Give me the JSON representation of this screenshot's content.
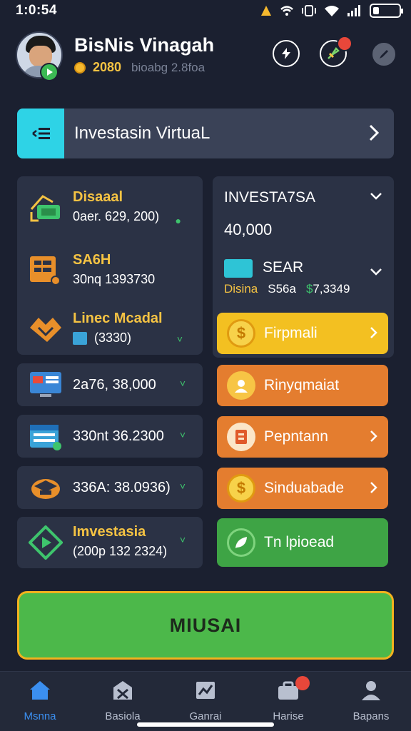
{
  "status_bar": {
    "time": "1:0:54"
  },
  "header": {
    "user_name": "BisNis Vinagah",
    "coins": "2080",
    "coins_sub": "bioabg 2.8foa"
  },
  "banner": {
    "title": "Investasin VirtuaL"
  },
  "left_panel": {
    "items": [
      {
        "title": "Disaaal",
        "sub": "0aer. 629, 200)"
      },
      {
        "title": "SA6H",
        "sub": "30nq 1393730"
      },
      {
        "title": "Linec Mcadal",
        "sub": "(3330)"
      }
    ]
  },
  "left_cards": [
    {
      "text": "2a76, 38,000"
    },
    {
      "text": "330nt 36.2300"
    },
    {
      "text": "336A: 38.0936)"
    }
  ],
  "left_tall_card": {
    "title": "Imvestasia",
    "sub": "(200p 132 2324)"
  },
  "right_panel": {
    "title": "INVESTA7SA",
    "amount": "40,000",
    "gear_label": "SEAR",
    "row": [
      "Disina",
      "S56a",
      "7,3349"
    ]
  },
  "action_buttons": [
    {
      "label": "Firpmali",
      "color": "#f3c021",
      "icon": "dollar-coin-icon"
    },
    {
      "label": "Rinyqmaiat",
      "color": "#e47d2f",
      "icon": "person-icon"
    },
    {
      "label": "Pepntann",
      "color": "#e47d2f",
      "icon": "document-icon"
    },
    {
      "label": "Sinduabade",
      "color": "#e47d2f",
      "icon": "dollar-coin-icon"
    },
    {
      "label": "Tn lpioead",
      "color": "#3ea445",
      "icon": "leaf-icon"
    }
  ],
  "cta": {
    "label": "MIUSAI"
  },
  "bottom_nav": [
    {
      "label": "Msnna",
      "icon": "home-icon"
    },
    {
      "label": "Basiola",
      "icon": "store-icon"
    },
    {
      "label": "Ganrai",
      "icon": "chart-icon"
    },
    {
      "label": "Harise",
      "icon": "briefcase-icon"
    },
    {
      "label": "Bapans",
      "icon": "profile-icon"
    }
  ],
  "colors": {
    "background": "#1b2030",
    "panel": "#2b3245",
    "accent_cyan": "#2ed3e6",
    "accent_gold": "#f5c343",
    "accent_green": "#4cb84a",
    "nav_active": "#3b8ff0"
  }
}
